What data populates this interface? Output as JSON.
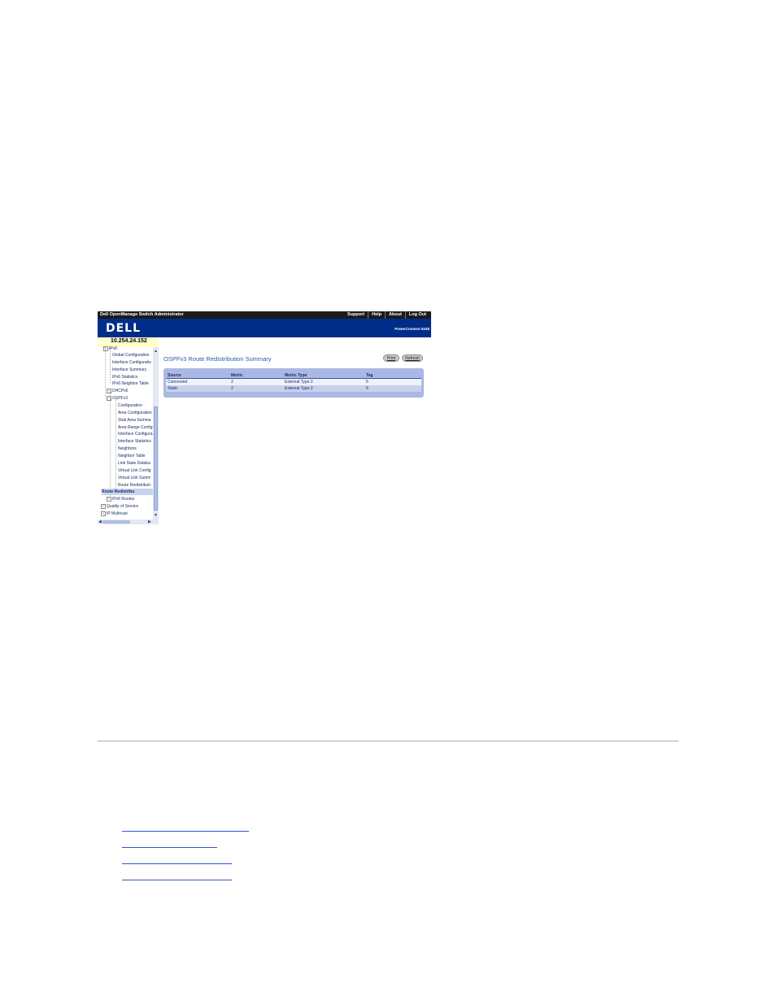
{
  "app": {
    "title": "Dell OpenManage Switch Administrator",
    "top_links": [
      "Support",
      "Help",
      "About",
      "Log Out"
    ],
    "logo": "DELL",
    "product": "PowerConnect 6248"
  },
  "ip_address": "10.254.24.152",
  "tree": {
    "items": [
      {
        "label": "IPv6",
        "expander": "minus"
      },
      {
        "label": "Global Configuration"
      },
      {
        "label": "Interface Configuratio"
      },
      {
        "label": "Interface Summary"
      },
      {
        "label": "IPv6 Statistics"
      },
      {
        "label": "IPv6 Neighbor Table"
      },
      {
        "label": "DHCPv6",
        "expander": "plus"
      },
      {
        "label": "OSPFv3",
        "expander": "minus"
      },
      {
        "label": "Configuration"
      },
      {
        "label": "Area Configuration"
      },
      {
        "label": "Stub Area Summa"
      },
      {
        "label": "Area Range Config"
      },
      {
        "label": "Interface Configura"
      },
      {
        "label": "Interface Statistics"
      },
      {
        "label": "Neighbors"
      },
      {
        "label": "Neighbor Table"
      },
      {
        "label": "Link State Databa"
      },
      {
        "label": "Virtual Link Config"
      },
      {
        "label": "Virtual Link Summ"
      },
      {
        "label": "Route Redistributi"
      },
      {
        "label": "Route Redistribu",
        "selected": true
      },
      {
        "label": "IPv6 Routes",
        "expander": "plus"
      },
      {
        "label": "Quality of Service",
        "expander": "plus"
      },
      {
        "label": "IP Multicast",
        "expander": "plus"
      }
    ]
  },
  "main": {
    "title": "OSPFv3 Route Redistribution Summary",
    "buttons": {
      "print": "Print",
      "refresh": "Refresh"
    },
    "table": {
      "headers": [
        "Source",
        "Metric",
        "Metric Type",
        "Tag"
      ],
      "rows": [
        [
          "Connected",
          "2",
          "External Type 2",
          "5"
        ],
        [
          "Static",
          "2",
          "External Type 2",
          "6"
        ]
      ]
    }
  },
  "colors": {
    "banner": "#002d8a",
    "topbar": "#1b1b1b",
    "title_blue": "#1f5fb0",
    "table_bg": "#aab8e3"
  }
}
